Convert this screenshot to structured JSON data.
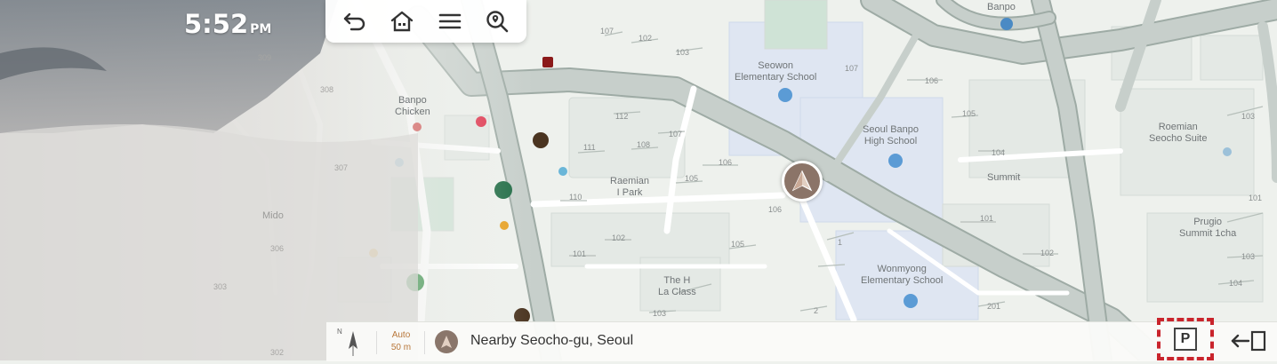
{
  "status": {
    "time": "5:52",
    "ampm": "PM"
  },
  "toolbar": {
    "icons": [
      "back-icon",
      "home-icon",
      "menu-icon",
      "search-location-icon"
    ]
  },
  "map": {
    "labels": {
      "banpo_top": "Banpo",
      "seowon": "Seowon\nElementary School",
      "banpo_chicken": "Banpo\nChicken",
      "seoul_banpo": "Seoul Banpo\nHigh School",
      "roemian_seocho": "Roemian\nSeocho Suite",
      "roemian_ipark": "Raemian\nI Park",
      "summit": "Summit",
      "prugio": "Prugio\nSummit 1cha",
      "mido": "Mido",
      "the_h": "The H\nLa Class",
      "wonmyong": "Wonmyong\nElementary School"
    },
    "numbers": {
      "n1": "107",
      "n2": "102",
      "n3": "103",
      "n4": "107",
      "n5": "106",
      "n6": "105",
      "n7": "112",
      "n8": "108",
      "n9": "107",
      "n10": "111",
      "n11": "106",
      "n12": "105",
      "n13": "110",
      "n14": "104",
      "n15": "101",
      "n16": "106",
      "n17": "102",
      "n18": "101",
      "n19": "105",
      "n20": "102",
      "n21": "103",
      "n22": "104",
      "n23": "103",
      "n24": "101",
      "n25": "1",
      "n26": "2",
      "n27": "201",
      "n28": "309",
      "n29": "308",
      "n30": "307",
      "n31": "306",
      "n32": "303",
      "n33": "302",
      "n34": "103"
    }
  },
  "bottom": {
    "compass_n": "N",
    "scale_mode": "Auto",
    "scale_value": "50 m",
    "address": "Nearby Seocho-gu, Seoul"
  },
  "colors": {
    "accent": "#c9242c",
    "car": "#8b7468",
    "road": "#c7cfcb",
    "road_edge": "#9eaba5",
    "school_pin": "#5b9bd5"
  }
}
